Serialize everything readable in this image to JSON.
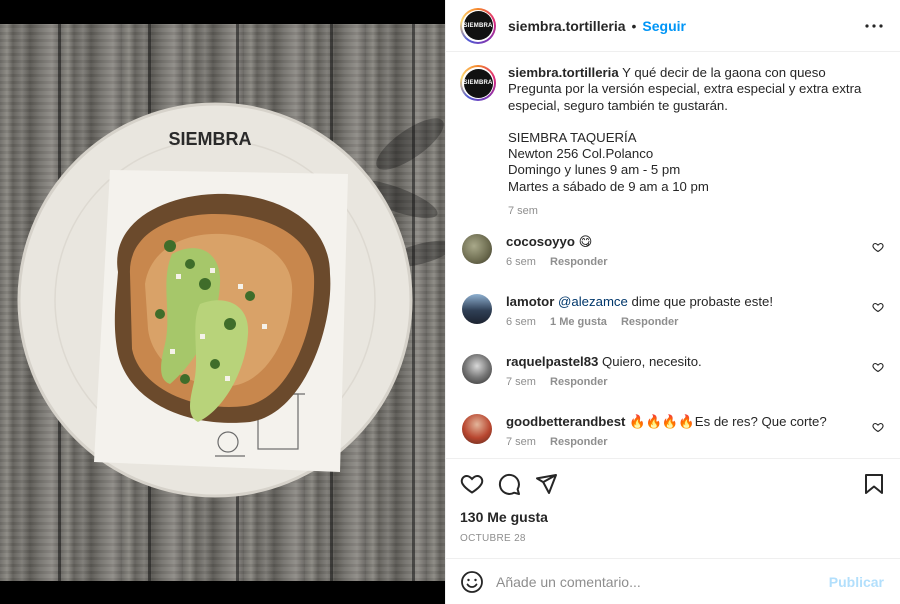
{
  "post": {
    "image": {
      "alt_brand": "SIEMBRA"
    },
    "header": {
      "username": "siembra.tortilleria",
      "separator": "•",
      "follow_label": "Seguir",
      "avatar_text": "SIEMBRA"
    },
    "caption": {
      "username": "siembra.tortilleria",
      "lines": [
        "Y qué decir de la gaona con queso",
        "Pregunta por la versión especial, extra especial y extra extra",
        "especial, seguro también te gustarán.",
        "",
        "SIEMBRA TAQUERÍA",
        "Newton 256 Col.Polanco",
        "Domingo y lunes 9 am - 5 pm",
        "Martes a sábado de 9 am a 10 pm"
      ],
      "time": "7 sem"
    },
    "comments": [
      {
        "username": "cocosoyyo",
        "text": "😋",
        "mention": "",
        "time": "6 sem",
        "likes": "",
        "reply": "Responder",
        "avatar_color": "#6b6a4e"
      },
      {
        "username": "lamotor",
        "mention": "@alezamce",
        "text": "dime que probaste este!",
        "time": "6 sem",
        "likes": "1 Me gusta",
        "reply": "Responder",
        "avatar_color": "#2f3f55"
      },
      {
        "username": "raquelpastel83",
        "text": "Quiero, necesito.",
        "mention": "",
        "time": "7 sem",
        "likes": "",
        "reply": "Responder",
        "avatar_color": "#4a4a4a"
      },
      {
        "username": "goodbetterandbest",
        "text": "🔥🔥🔥🔥Es de res? Que corte?",
        "mention": "",
        "time": "7 sem",
        "likes": "",
        "reply": "Responder",
        "avatar_color": "#7c3a2c"
      }
    ],
    "likes_label": "130 Me gusta",
    "date": "OCTUBRE 28",
    "add_comment": {
      "placeholder": "Añade un comentario...",
      "publish_label": "Publicar"
    }
  },
  "icons": {
    "more": "more-horizontal-icon",
    "like": "heart-outline-icon",
    "comment": "speech-bubble-icon",
    "share": "paper-plane-icon",
    "save": "bookmark-icon",
    "emoji": "smiley-icon"
  },
  "colors": {
    "link_blue": "#0095f6",
    "publish_disabled": "#b2dffc",
    "muted": "#8e8e8e",
    "text": "#262626",
    "mention": "#00376b"
  }
}
